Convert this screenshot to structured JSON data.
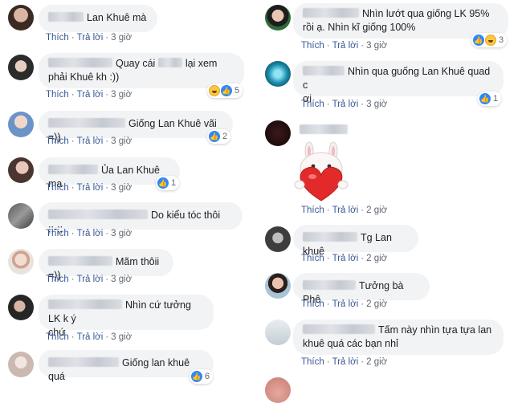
{
  "ui": {
    "like_label": "Thích",
    "reply_label": "Trả lời",
    "separator": "·"
  },
  "left_comments": [
    {
      "text": "Lan Khuê mà",
      "time": "3 giờ"
    },
    {
      "text_a": "Quay cái",
      "text_b": "lại xem",
      "text_c": "phải Khuê kh :))",
      "time": "3 giờ",
      "react_count": "5"
    },
    {
      "text": "Giống Lan Khuê vãi =))",
      "time": "3 giờ",
      "react_count": "2"
    },
    {
      "text": "Ủa Lan Khuê ma",
      "time": "3 giờ",
      "react_count": "1"
    },
    {
      "text": "Do kiểu tóc thôi ;;-;;",
      "time": "3 giờ"
    },
    {
      "text": "Mãm thôii =))",
      "time": "3 giờ"
    },
    {
      "text_a": "Nhìn cứ tưởng LK k ý",
      "text_b": "chứ",
      "time": "3 giờ"
    },
    {
      "text": "Giống lan khuê quá",
      "time": "3 giờ",
      "react_count": "6"
    }
  ],
  "right_comments": [
    {
      "text_a": "Nhìn lướt qua giống LK 95%",
      "text_b": "rồi ạ. Nhìn kĩ giống 100%",
      "time": "3 giờ",
      "react_count": "3"
    },
    {
      "text_a": "Nhìn qua guống Lan Khuê quad c",
      "text_b": "ơi",
      "time": "3 giờ",
      "react_count": "1"
    },
    {
      "time": "2 giờ"
    },
    {
      "text": "Tg Lan khuê",
      "time": "2 giờ"
    },
    {
      "text": "Tưởng bà Phê",
      "time": "2 giờ"
    },
    {
      "text_a": "Tấm này nhìn tựa tựa lan",
      "text_b": "khuê quá các bạn nhỉ",
      "time": "2 giờ"
    }
  ],
  "colors": {
    "bubble": "#f2f3f5",
    "link": "#385898",
    "meta": "#606770",
    "like": "#2d88ff"
  }
}
